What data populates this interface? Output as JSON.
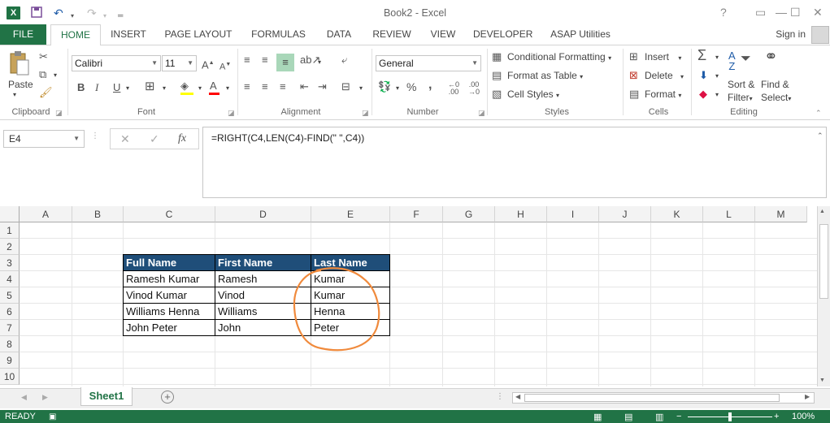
{
  "window": {
    "title": "Book2 - Excel",
    "help": "?",
    "ribbon_display": "▭",
    "minimize": "—",
    "maximize": "☐",
    "close": "✕"
  },
  "qat": {
    "save": "💾",
    "undo": "↶",
    "redo": "↷",
    "customize": "⌄"
  },
  "tabs": {
    "file": "FILE",
    "items": [
      "HOME",
      "INSERT",
      "PAGE LAYOUT",
      "FORMULAS",
      "DATA",
      "REVIEW",
      "VIEW",
      "DEVELOPER",
      "ASAP Utilities"
    ],
    "signin": "Sign in"
  },
  "ribbon": {
    "clipboard": {
      "label": "Clipboard",
      "paste": "Paste"
    },
    "font": {
      "label": "Font",
      "name": "Calibri",
      "size": "11",
      "grow": "A",
      "shrink": "A",
      "bold": "B",
      "italic": "I",
      "underline": "U"
    },
    "alignment": {
      "label": "Alignment"
    },
    "number": {
      "label": "Number",
      "format": "General",
      "percent": "%",
      "comma": ","
    },
    "styles": {
      "label": "Styles",
      "conditional": "Conditional Formatting",
      "table": "Format as Table",
      "cell_styles": "Cell Styles"
    },
    "cells": {
      "label": "Cells",
      "insert": "Insert",
      "delete": "Delete",
      "format": "Format"
    },
    "editing": {
      "label": "Editing",
      "sort": "Sort &",
      "sort2": "Filter",
      "find": "Find &",
      "find2": "Select"
    }
  },
  "formula_bar": {
    "name_box": "E4",
    "formula": "=RIGHT(C4,LEN(C4)-FIND(\" \",C4))"
  },
  "columns": [
    "A",
    "B",
    "C",
    "D",
    "E",
    "F",
    "G",
    "H",
    "I",
    "J",
    "K",
    "L",
    "M"
  ],
  "rows": [
    "1",
    "2",
    "3",
    "4",
    "5",
    "6",
    "7",
    "8",
    "9",
    "10"
  ],
  "table": {
    "headers": [
      "Full Name",
      "First Name",
      "Last Name"
    ],
    "rows": [
      [
        "Ramesh Kumar",
        "Ramesh",
        "Kumar"
      ],
      [
        "Vinod Kumar",
        "Vinod",
        "Kumar"
      ],
      [
        "Williams Henna",
        "Williams",
        "Henna"
      ],
      [
        "John Peter",
        "John",
        "Peter"
      ]
    ]
  },
  "sheets": {
    "active": "Sheet1",
    "add": "+"
  },
  "status": {
    "ready": "READY",
    "zoom": "100%"
  },
  "colors": {
    "excel_green": "#217346",
    "header_blue": "#1f4e79",
    "annotation": "#f08a3c"
  }
}
